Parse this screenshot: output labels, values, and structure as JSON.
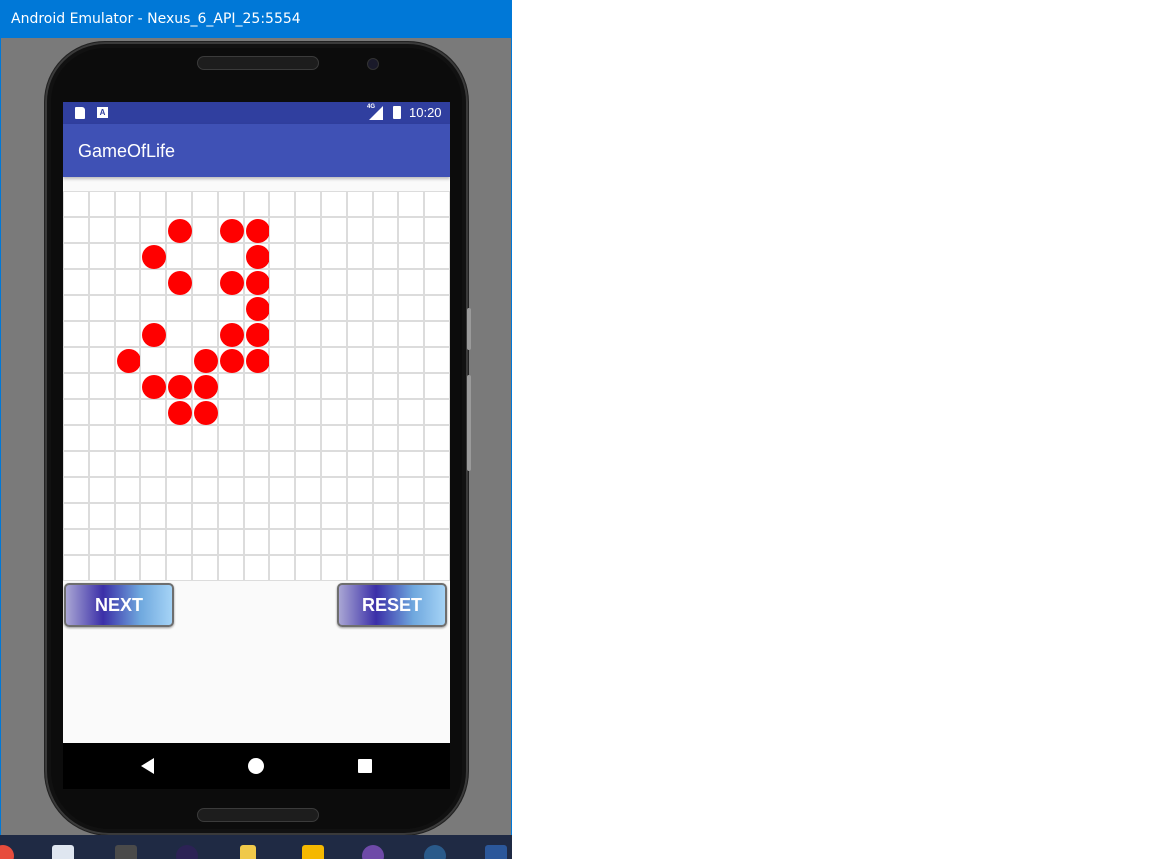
{
  "window": {
    "title": "Android Emulator - Nexus_6_API_25:5554"
  },
  "status_bar": {
    "time": "10:20",
    "network_label": "4G",
    "notification_icons": [
      "sd-card-icon",
      "a-icon"
    ]
  },
  "app": {
    "title": "GameOfLife",
    "colors": {
      "app_bar": "#3f51b5",
      "status_bar": "#303f9f",
      "alive_cell": "#ff0000"
    }
  },
  "grid": {
    "rows": 15,
    "cols": 15,
    "alive_cells": [
      [
        1,
        4
      ],
      [
        1,
        6
      ],
      [
        1,
        7
      ],
      [
        2,
        3
      ],
      [
        2,
        7
      ],
      [
        3,
        4
      ],
      [
        3,
        6
      ],
      [
        3,
        7
      ],
      [
        4,
        7
      ],
      [
        5,
        3
      ],
      [
        5,
        6
      ],
      [
        5,
        7
      ],
      [
        6,
        2
      ],
      [
        6,
        5
      ],
      [
        6,
        6
      ],
      [
        6,
        7
      ],
      [
        7,
        3
      ],
      [
        7,
        4
      ],
      [
        7,
        5
      ],
      [
        8,
        4
      ],
      [
        8,
        5
      ]
    ]
  },
  "buttons": {
    "next_label": "NEXT",
    "reset_label": "RESET"
  },
  "nav": {
    "back": "back-icon",
    "home": "home-icon",
    "recent": "recent-apps-icon"
  },
  "taskbar": {
    "icons": [
      "chrome-icon",
      "store-icon",
      "sublime-icon",
      "eclipse-icon",
      "file-explorer-icon",
      "search-app-icon",
      "github-icon",
      "settings-icon",
      "word-icon"
    ]
  }
}
